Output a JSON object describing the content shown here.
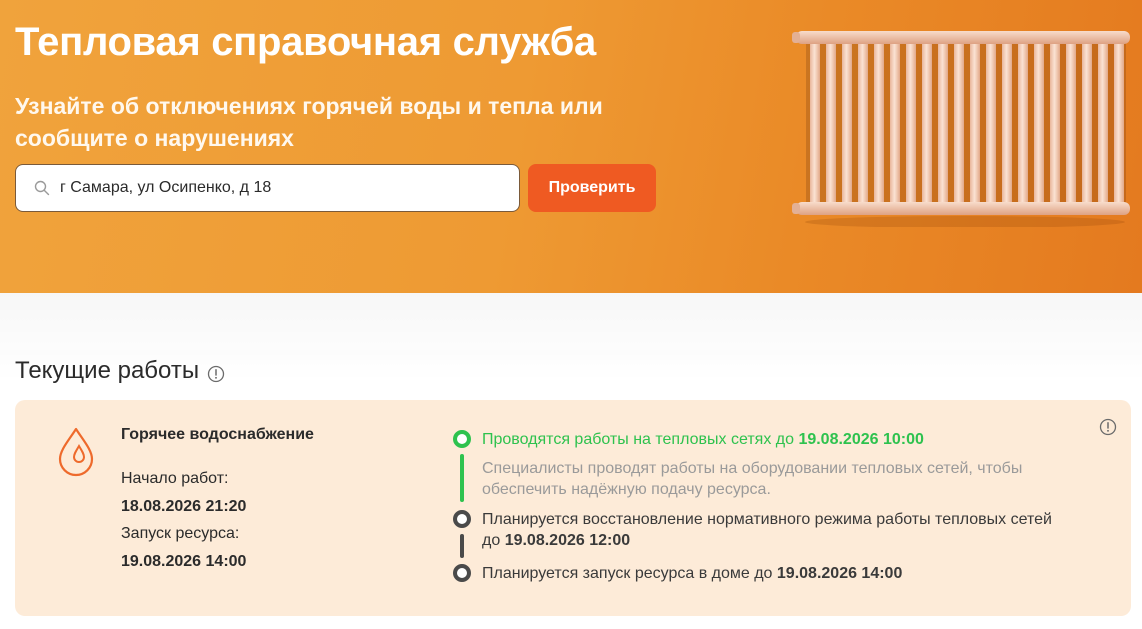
{
  "hero": {
    "title": "Тепловая справочная служба",
    "subtitle": "Узнайте об отключениях горячей воды и тепла или сообщите о нарушениях",
    "search": {
      "value": "г Самара, ул Осипенко, д 18",
      "icon": "search-icon"
    },
    "check_button": "Проверить",
    "image": "radiator-illustration"
  },
  "colors": {
    "hero_start": "#f0a33c",
    "hero_end": "#e47a1f",
    "accent_button": "#ef5a22",
    "card_bg": "#fdebd8",
    "status_active": "#2ec24e",
    "status_pending": "#4a4a4a"
  },
  "current_works": {
    "title": "Текущие работы",
    "title_icon": "info-icon",
    "card": {
      "service_icon": "water-drop-icon",
      "service_name": "Горячее водоснабжение",
      "start_label": "Начало работ:",
      "start_value": "18.08.2026 21:20",
      "launch_label": "Запуск ресурса:",
      "launch_value": "19.08.2026 14:00",
      "info_icon": "info-icon",
      "timeline": [
        {
          "status": "active",
          "text": "Проводятся работы на тепловых сетях до ",
          "date": "19.08.2026 10:00",
          "description": "Специалисты проводят работы на оборудовании тепловых сетей, чтобы обеспечить надёжную подачу ресурса."
        },
        {
          "status": "pending",
          "text": "Планируется восстановление нормативного режима работы тепловых сетей",
          "text_line2": "до ",
          "date": "19.08.2026 12:00"
        },
        {
          "status": "pending",
          "text": "Планируется запуск ресурса в доме до ",
          "date": "19.08.2026 14:00"
        }
      ]
    }
  }
}
